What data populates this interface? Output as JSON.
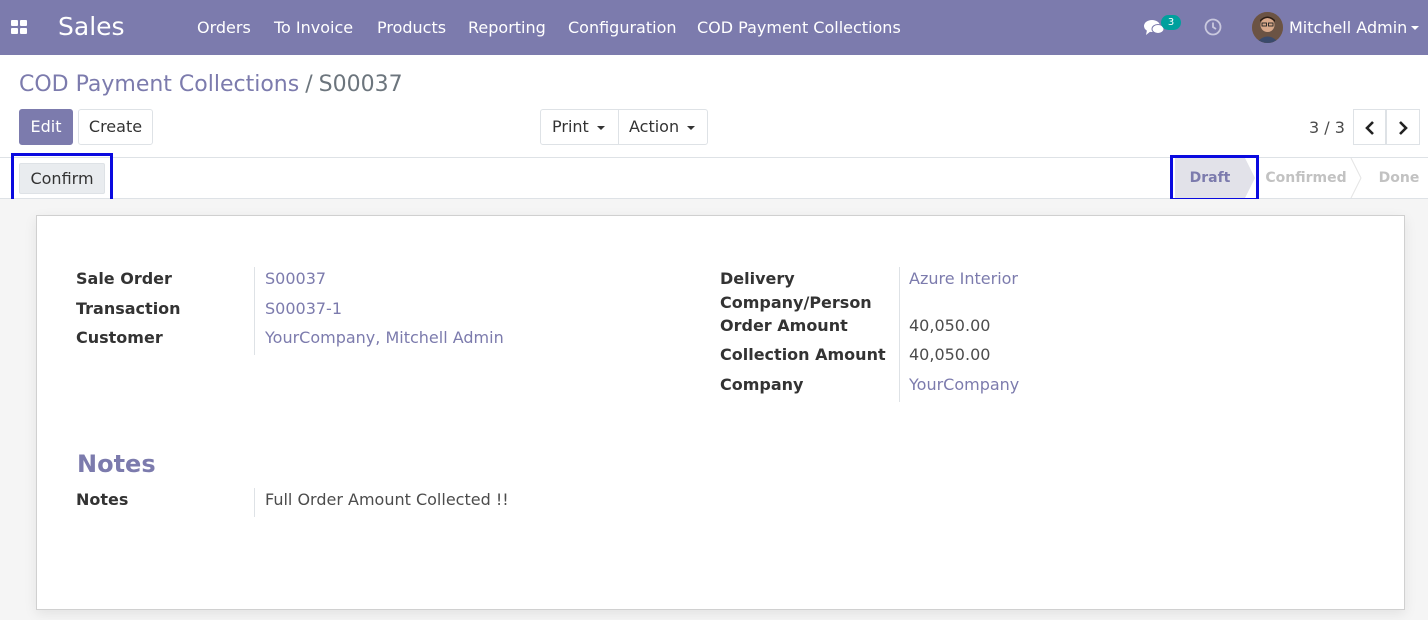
{
  "navbar": {
    "app_name": "Sales",
    "menu": [
      "Orders",
      "To Invoice",
      "Products",
      "Reporting",
      "Configuration",
      "COD Payment Collections"
    ],
    "messages_count": "3",
    "user_name": "Mitchell Admin"
  },
  "breadcrumb": {
    "parent": "COD Payment Collections",
    "separator": "/",
    "current": "S00037"
  },
  "toolbar": {
    "edit_label": "Edit",
    "create_label": "Create",
    "print_label": "Print",
    "action_label": "Action"
  },
  "pager": {
    "value": "3 / 3"
  },
  "statusbar": {
    "confirm_label": "Confirm",
    "stages": [
      "Draft",
      "Confirmed",
      "Done"
    ],
    "active_stage": "Draft"
  },
  "form": {
    "left_fields": [
      {
        "label": "Sale Order",
        "value": "S00037",
        "link": true
      },
      {
        "label": "Transaction",
        "value": "S00037-1",
        "link": true
      },
      {
        "label": "Customer",
        "value": "YourCompany, Mitchell Admin",
        "link": true
      }
    ],
    "right_fields": [
      {
        "label": "Delivery Company/Person",
        "value": "Azure Interior",
        "link": true
      },
      {
        "label": "Order Amount",
        "value": "40,050.00",
        "link": false
      },
      {
        "label": "Collection Amount",
        "value": "40,050.00",
        "link": false
      },
      {
        "label": "Company",
        "value": "YourCompany",
        "link": true
      }
    ],
    "notes_section_title": "Notes",
    "notes_label": "Notes",
    "notes_value": "Full Order Amount Collected !!"
  },
  "colors": {
    "brand": "#7c7bad",
    "highlight": "#0a0adf",
    "badge": "#00a09d"
  }
}
